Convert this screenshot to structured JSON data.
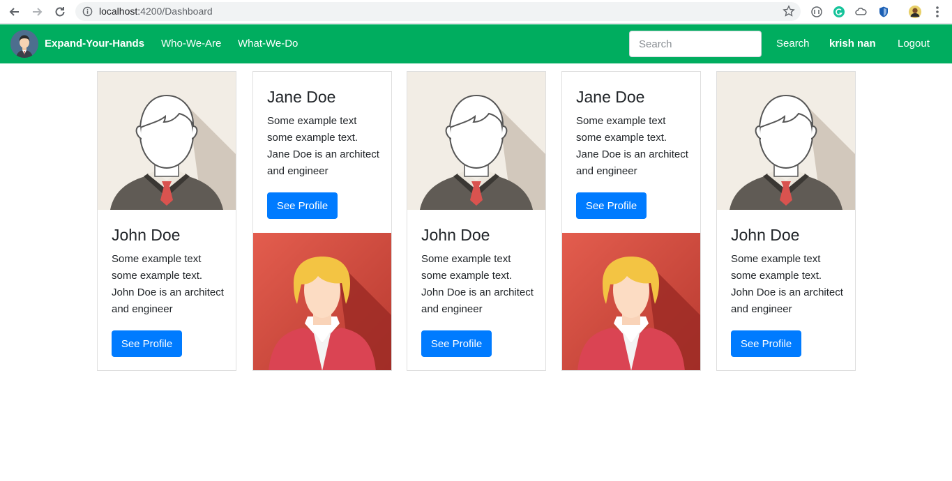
{
  "browser": {
    "url_host": "localhost:",
    "url_rest": "4200/Dashboard"
  },
  "navbar": {
    "brand": "Expand-Your-Hands",
    "links": [
      "Who-We-Are",
      "What-We-Do"
    ],
    "search_placeholder": "Search",
    "search_button": "Search",
    "user": "krish nan",
    "logout": "Logout",
    "color": "#00ad5f"
  },
  "cards": [
    {
      "name": "John Doe",
      "text": "Some example text some example text. John Doe is an architect and engineer",
      "button": "See Profile",
      "avatar": "male-avatar",
      "image_position": "top"
    },
    {
      "name": "Jane Doe",
      "text": "Some example text some example text. Jane Doe is an architect and engineer",
      "button": "See Profile",
      "avatar": "female-avatar",
      "image_position": "bottom"
    },
    {
      "name": "John Doe",
      "text": "Some example text some example text. John Doe is an architect and engineer",
      "button": "See Profile",
      "avatar": "male-avatar",
      "image_position": "top"
    },
    {
      "name": "Jane Doe",
      "text": "Some example text some example text. Jane Doe is an architect and engineer",
      "button": "See Profile",
      "avatar": "female-avatar",
      "image_position": "bottom"
    },
    {
      "name": "John Doe",
      "text": "Some example text some example text. John Doe is an architect and engineer",
      "button": "See Profile",
      "avatar": "male-avatar",
      "image_position": "top"
    }
  ],
  "colors": {
    "button": "#007bff"
  }
}
